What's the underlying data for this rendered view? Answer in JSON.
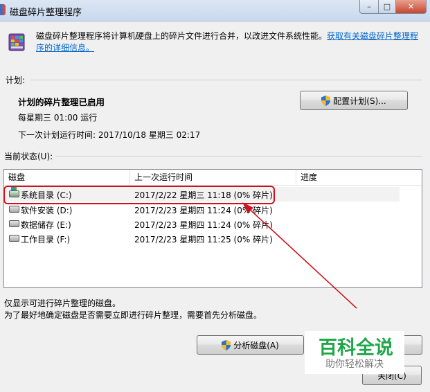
{
  "window": {
    "title": "磁盘碎片整理程序",
    "minimize_symbol": "–",
    "maximize_symbol": "□",
    "close_symbol": "✕"
  },
  "header": {
    "icon": "defrag-app-icon",
    "description": "磁盘碎片整理程序将计算机硬盘上的碎片文件进行合并，以改进文件系统性能。",
    "link_text": "获取有关磁盘碎片整理程序的详细信息。"
  },
  "schedule": {
    "group_label": "计划:",
    "status": "计划的碎片整理已启用",
    "frequency": "每星期三  01:00 运行",
    "next_run": "下一次计划运行时间: 2017/10/18 星期三 02:17",
    "config_button": "配置计划(S)..."
  },
  "current_state": {
    "group_label": "当前状态(U):",
    "columns": [
      "磁盘",
      "上一次运行时间",
      "进度"
    ],
    "disks": [
      {
        "name": "系统目录 (C:)",
        "last_run": "2017/2/22 星期三 11:18 (0% 碎片)",
        "selected": true
      },
      {
        "name": "软件安装 (D:)",
        "last_run": "2017/2/23 星期四 11:24 (0% 碎片)",
        "selected": false
      },
      {
        "name": "数据储存 (E:)",
        "last_run": "2017/2/23 星期四 11:24 (0% 碎片)",
        "selected": false
      },
      {
        "name": "工作目录 (F:)",
        "last_run": "2017/2/23 星期四 11:25 (0% 碎片)",
        "selected": false
      }
    ]
  },
  "notes": {
    "line1": "仅显示可进行碎片整理的磁盘。",
    "line2": "为了最好地确定磁盘是否需要立即进行碎片整理，需要首先分析磁盘。"
  },
  "buttons": {
    "analyze": "分析磁盘(A)",
    "close": "关闭(C)"
  },
  "watermark": {
    "title": "百科全说",
    "subtitle": "助你轻松解决"
  },
  "colors": {
    "annotation": "#d0121e",
    "link": "#0066cc",
    "watermark_green": "#1fa74a"
  }
}
